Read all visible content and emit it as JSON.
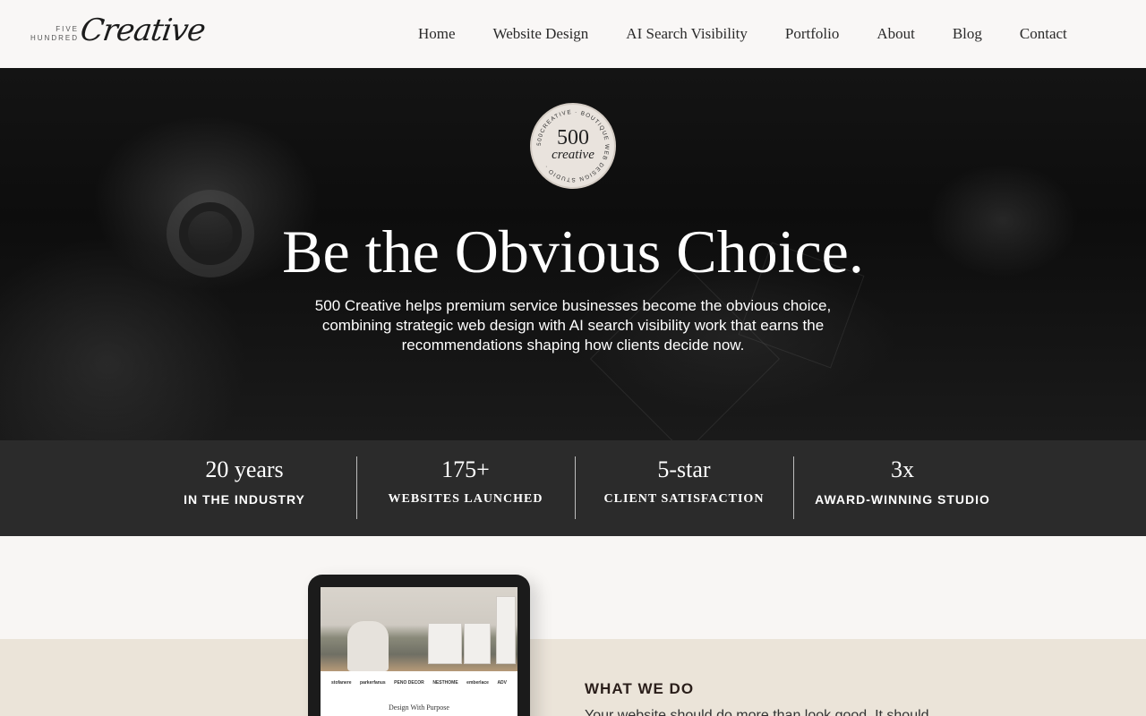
{
  "header": {
    "logo": {
      "top": "FIVE",
      "middle": "HUNDRED",
      "script": "Creative"
    },
    "nav": [
      {
        "label": "Home"
      },
      {
        "label": "Website Design"
      },
      {
        "label": "AI Search Visibility"
      },
      {
        "label": "Portfolio"
      },
      {
        "label": "About"
      },
      {
        "label": "Blog"
      },
      {
        "label": "Contact"
      }
    ]
  },
  "hero": {
    "badge": {
      "number": "500",
      "word": "creative",
      "ring_text": "500CREATIVE · BOUTIQUE WEB DESIGN STUDIO ·"
    },
    "title": "Be the Obvious Choice.",
    "subtitle": "500 Creative helps premium service businesses become the obvious choice, combining strategic web design with AI search visibility work that earns the recommendations shaping how clients decide now."
  },
  "stats": [
    {
      "value": "20 years",
      "label": "IN THE INDUSTRY"
    },
    {
      "value": "175+",
      "label": "WEBSITES LAUNCHED"
    },
    {
      "value": "5-star",
      "label": "CLIENT SATISFACTION"
    },
    {
      "value": "3x",
      "label": "AWARD-WINNING STUDIO"
    }
  ],
  "showcase": {
    "tablet_logos": [
      "stofanere",
      "parkerfanus",
      "PENO DECOR",
      "NESTHOME",
      "emberlace",
      "ADV"
    ],
    "tablet_tagline": "Design With Purpose"
  },
  "what_we_do": {
    "heading": "WHAT WE DO",
    "text": "Your website should do more than look good. It should"
  },
  "colors": {
    "header_bg": "#f9f7f6",
    "hero_bg": "#0d0d0d",
    "stats_bg": "#2b2b2b",
    "beige": "#ebe4d9",
    "badge_bg": "#e9e3dd"
  }
}
